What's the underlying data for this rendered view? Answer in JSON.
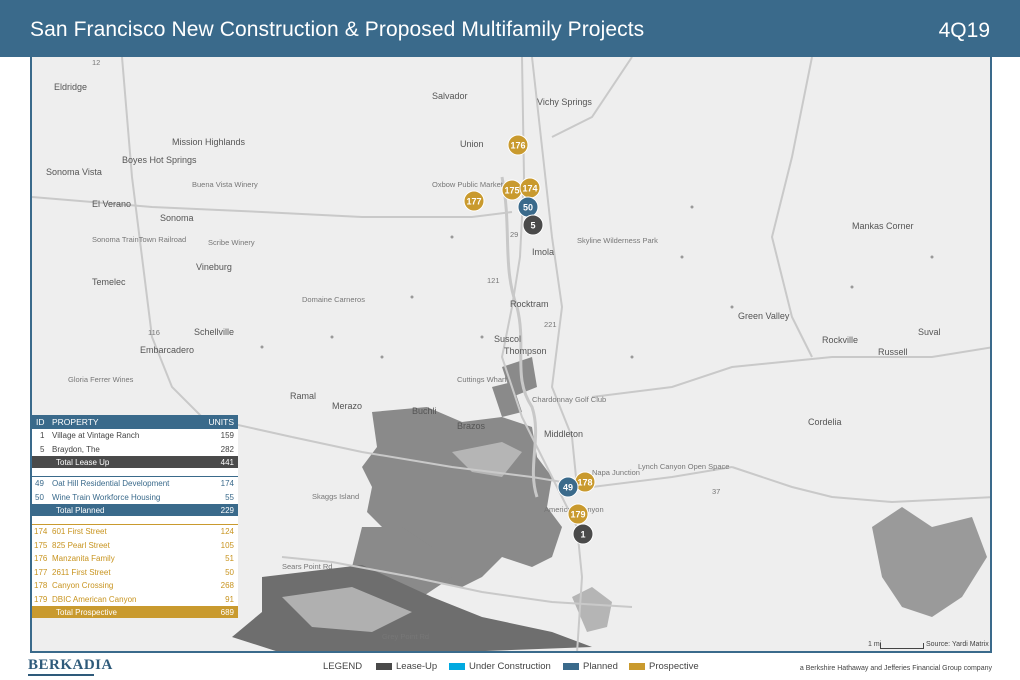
{
  "header": {
    "title": "San Francisco New Construction & Proposed Multifamily Projects",
    "quarter": "4Q19"
  },
  "colors": {
    "header_bg": "#3a6a8b",
    "lease_up": "#4a4a4a",
    "under_construction": "#00a9e0",
    "planned": "#3a6a8b",
    "prospective": "#c99a2e"
  },
  "map": {
    "places": [
      "Eldridge",
      "Salvador",
      "Vichy Springs",
      "Mission Highlands",
      "Boyes Hot Springs",
      "Sonoma Vista",
      "Union",
      "Oxbow Public Market",
      "El Verano",
      "Sonoma",
      "Sonoma TrainTown Railroad",
      "Vineburg",
      "Temelec",
      "Domaine Carneros",
      "Schellville",
      "Embarcadero",
      "Gloria Ferrer Wines",
      "Imola",
      "Rocktram",
      "Suscol",
      "Thompson",
      "Cuttings Wharf",
      "Ramal",
      "Merazo",
      "Buchli",
      "Brazos",
      "Middleton",
      "Chardonnay Golf Club",
      "Napa Junction",
      "American Canyon",
      "Mankas Corner",
      "Green Valley",
      "Rockville",
      "Russell",
      "Suval",
      "Cordelia",
      "Lynch Canyon Open Space",
      "Skaggs Island",
      "Skyline Wilderness Park",
      "Buena Vista Winery",
      "Scribe Winery"
    ],
    "roads": [
      "12",
      "29",
      "121",
      "116",
      "37",
      "221",
      "Grey Point Rd",
      "Sears Point Rd"
    ],
    "markers": [
      {
        "id": "176",
        "status": "prospective"
      },
      {
        "id": "175",
        "status": "prospective"
      },
      {
        "id": "174",
        "status": "prospective"
      },
      {
        "id": "177",
        "status": "prospective"
      },
      {
        "id": "50",
        "status": "planned"
      },
      {
        "id": "5",
        "status": "lease_up"
      },
      {
        "id": "178",
        "status": "prospective"
      },
      {
        "id": "49",
        "status": "planned"
      },
      {
        "id": "179",
        "status": "prospective"
      },
      {
        "id": "1",
        "status": "lease_up"
      }
    ],
    "scale_label": "1 mi",
    "source": "Source: Yardi Matrix"
  },
  "table": {
    "col_id": "ID",
    "col_property": "PROPERTY",
    "col_units": "UNITS",
    "lease_up": {
      "rows": [
        {
          "id": "1",
          "name": "Village at Vintage Ranch",
          "units": "159"
        },
        {
          "id": "5",
          "name": "Braydon, The",
          "units": "282"
        }
      ],
      "total_label": "Total Lease Up",
      "total_units": "441"
    },
    "planned": {
      "rows": [
        {
          "id": "49",
          "name": "Oat Hill Residential Development",
          "units": "174"
        },
        {
          "id": "50",
          "name": "Wine Train Workforce Housing",
          "units": "55"
        }
      ],
      "total_label": "Total Planned",
      "total_units": "229"
    },
    "prospective": {
      "rows": [
        {
          "id": "174",
          "name": "601 First Street",
          "units": "124"
        },
        {
          "id": "175",
          "name": "825 Pearl Street",
          "units": "105"
        },
        {
          "id": "176",
          "name": "Manzanita Family",
          "units": "51"
        },
        {
          "id": "177",
          "name": "2611 First Street",
          "units": "50"
        },
        {
          "id": "178",
          "name": "Canyon Crossing",
          "units": "268"
        },
        {
          "id": "179",
          "name": "DBIC American Canyon",
          "units": "91"
        }
      ],
      "total_label": "Total Prospective",
      "total_units": "689"
    }
  },
  "footer": {
    "logo": "BERKADIA",
    "legend_title": "LEGEND",
    "legend_items": [
      "Lease-Up",
      "Under Construction",
      "Planned",
      "Prospective"
    ],
    "tagline": "a Berkshire Hathaway and Jefferies Financial Group company"
  }
}
